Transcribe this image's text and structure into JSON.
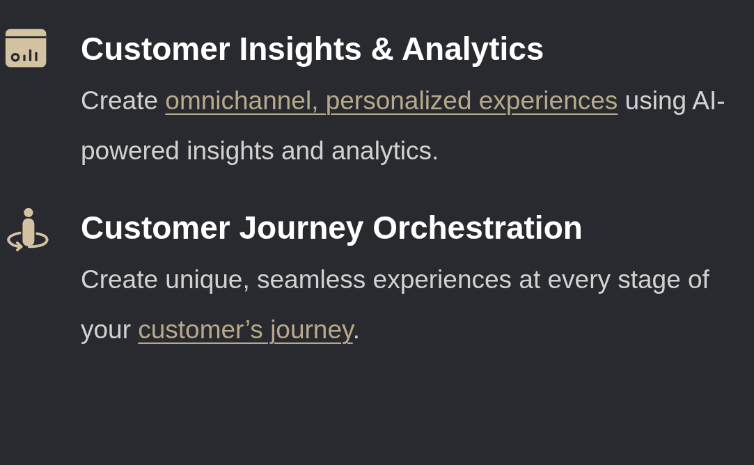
{
  "features": [
    {
      "kind": "analytics",
      "title": "Customer Insights & Analytics",
      "description": [
        {
          "text": "Create "
        },
        {
          "link": "omnichannel, personalized experiences"
        },
        {
          "text": " using AI-powered insights and analytics."
        }
      ]
    },
    {
      "kind": "journey",
      "title": "Customer Journey Orchestration",
      "description": [
        {
          "text": "Create unique, seamless experiences at every stage of your "
        },
        {
          "link": "customer’s journey"
        },
        {
          "text": "."
        }
      ]
    }
  ]
}
